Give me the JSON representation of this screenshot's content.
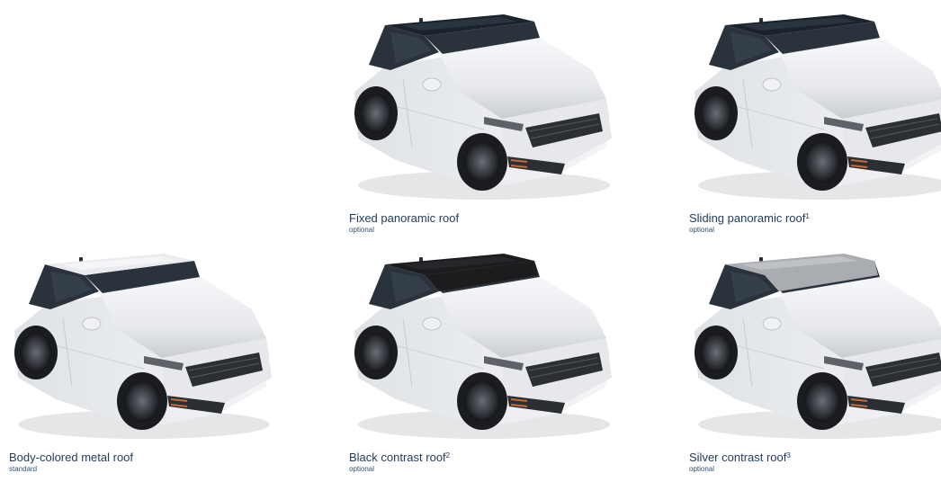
{
  "options": [
    {
      "id": "fixed-panoramic",
      "title": "Fixed panoramic roof",
      "footnote": "",
      "status": "optional",
      "roof_type": "glass",
      "roof_color": "#1a232c"
    },
    {
      "id": "sliding-panoramic",
      "title": "Sliding panoramic roof",
      "footnote": "1",
      "status": "optional",
      "roof_type": "glass",
      "roof_color": "#1a232c"
    },
    {
      "id": "body-colored",
      "title": "Body-colored metal roof",
      "footnote": "",
      "status": "standard",
      "roof_type": "metal",
      "roof_color": "#e9ebee"
    },
    {
      "id": "black-contrast",
      "title": "Black contrast roof",
      "footnote": "2",
      "status": "optional",
      "roof_type": "contrast",
      "roof_color": "#1c1c1e"
    },
    {
      "id": "silver-contrast",
      "title": "Silver contrast roof",
      "footnote": "3",
      "status": "optional",
      "roof_type": "contrast",
      "roof_color": "#a9acb1"
    }
  ],
  "colors": {
    "caption_text": "#1f3b5c",
    "car_body": "#eef0f3",
    "car_glass": "#2a333c"
  }
}
